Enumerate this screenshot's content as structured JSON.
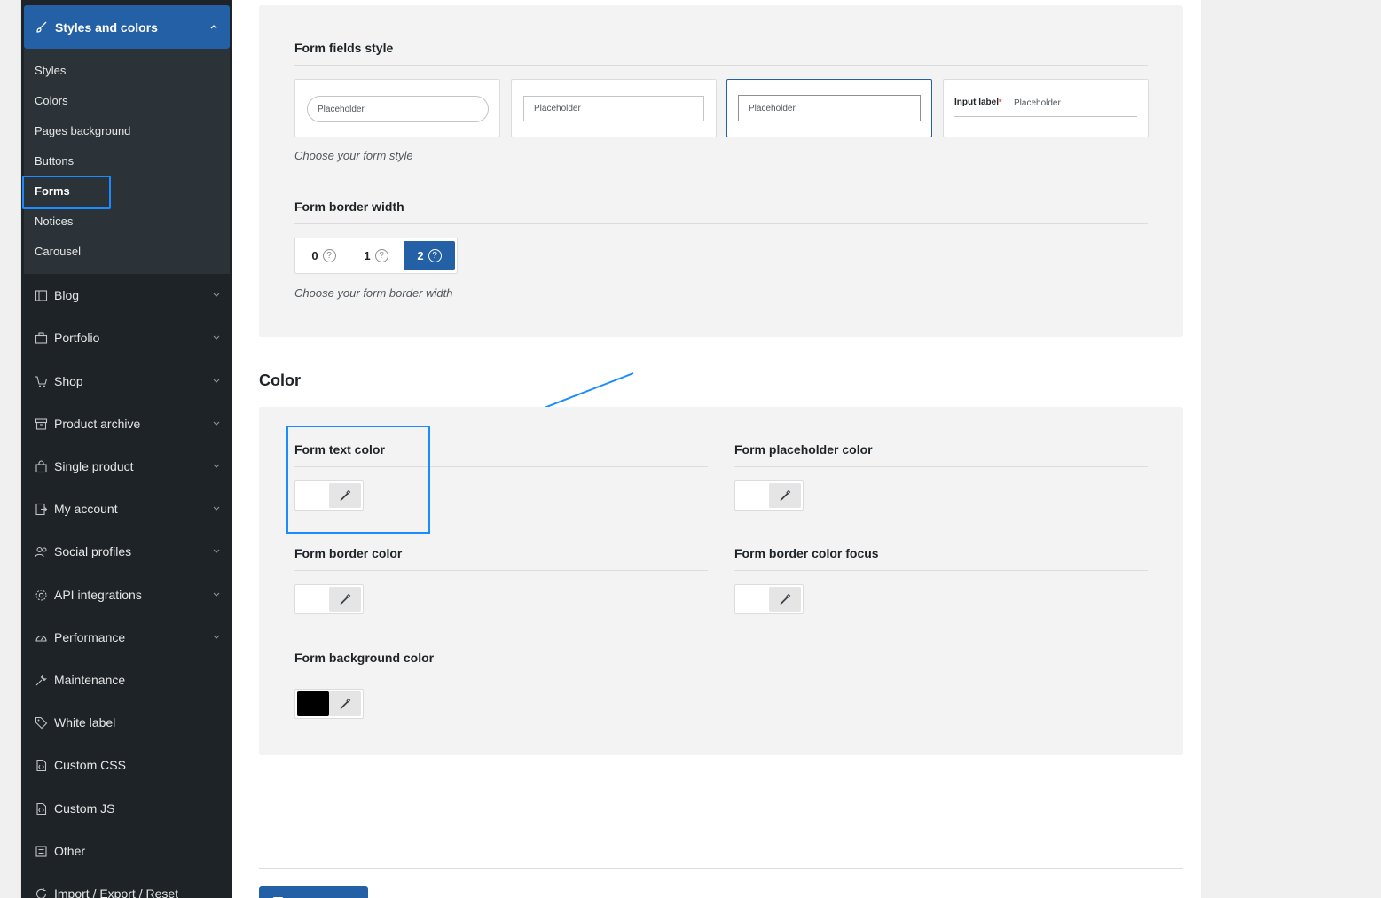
{
  "sidebar": {
    "head": {
      "label": "Styles and colors",
      "icon": "brush-icon"
    },
    "sub_items": [
      {
        "label": "Styles"
      },
      {
        "label": "Colors"
      },
      {
        "label": "Pages background"
      },
      {
        "label": "Buttons"
      },
      {
        "label": "Forms"
      },
      {
        "label": "Notices"
      },
      {
        "label": "Carousel"
      }
    ],
    "nav_items": [
      {
        "label": "Blog",
        "icon": "blog-icon"
      },
      {
        "label": "Portfolio",
        "icon": "briefcase-icon"
      },
      {
        "label": "Shop",
        "icon": "cart-icon"
      },
      {
        "label": "Product archive",
        "icon": "archive-icon"
      },
      {
        "label": "Single product",
        "icon": "bag-icon"
      },
      {
        "label": "My account",
        "icon": "account-icon"
      },
      {
        "label": "Social profiles",
        "icon": "people-icon"
      },
      {
        "label": "API integrations",
        "icon": "gear-icon"
      },
      {
        "label": "Performance",
        "icon": "gauge-icon"
      },
      {
        "label": "Maintenance",
        "icon": "wrench-icon"
      },
      {
        "label": "White label",
        "icon": "tag-icon"
      },
      {
        "label": "Custom CSS",
        "icon": "css-file-icon"
      },
      {
        "label": "Custom JS",
        "icon": "js-file-icon"
      },
      {
        "label": "Other",
        "icon": "other-icon"
      },
      {
        "label": "Import / Export / Reset",
        "icon": "import-export-icon"
      }
    ]
  },
  "form_fields_style": {
    "title": "Form fields style",
    "hint": "Choose your form style",
    "placeholder": "Placeholder",
    "input_label": "Input label",
    "required_mark": "*",
    "selected_index": 2
  },
  "form_border_width": {
    "title": "Form border width",
    "hint": "Choose your form border width",
    "options": [
      "0",
      "1",
      "2"
    ],
    "help_glyph": "?",
    "selected": "2"
  },
  "color_section": {
    "heading": "Color",
    "fields": {
      "text_color": {
        "label": "Form text color",
        "value": "#ffffff"
      },
      "placeholder_color": {
        "label": "Form placeholder color",
        "value": "#ffffff"
      },
      "border_color": {
        "label": "Form border color",
        "value": "#ffffff"
      },
      "border_focus": {
        "label": "Form border color focus",
        "value": "#ffffff"
      },
      "background": {
        "label": "Form background color",
        "value": "#000000"
      }
    }
  },
  "colors": {
    "accent": "#2460a6",
    "annotation": "#1a8cff",
    "sidebar_bg": "#1d2327"
  }
}
